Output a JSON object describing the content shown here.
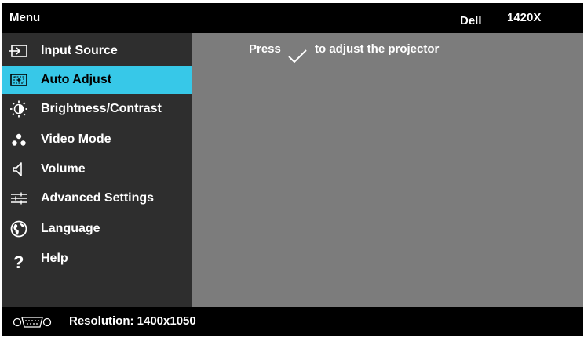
{
  "header": {
    "menu_title": "Menu",
    "brand": "Dell",
    "model": "1420X"
  },
  "sidebar": {
    "items": [
      {
        "label": "Input Source",
        "icon": "input-source-icon",
        "selected": false
      },
      {
        "label": "Auto Adjust",
        "icon": "auto-adjust-icon",
        "selected": true
      },
      {
        "label": "Brightness/Contrast",
        "icon": "brightness-icon",
        "selected": false
      },
      {
        "label": "Video Mode",
        "icon": "video-mode-icon",
        "selected": false
      },
      {
        "label": "Volume",
        "icon": "volume-icon",
        "selected": false
      },
      {
        "label": "Advanced Settings",
        "icon": "sliders-icon",
        "selected": false
      },
      {
        "label": "Language",
        "icon": "globe-icon",
        "selected": false
      },
      {
        "label": "Help",
        "icon": "help-icon",
        "selected": false
      }
    ]
  },
  "content": {
    "hint_press": "Press",
    "hint_rest": "to adjust the projector",
    "hint_icon": "checkmark-icon"
  },
  "footer": {
    "resolution": "Resolution: 1400x1050",
    "icon": "vga-connector-icon"
  },
  "colors": {
    "selected_bg": "#37c8e8",
    "sidebar_bg": "#2e2e2e",
    "content_bg": "#7c7c7c",
    "bar_bg": "#000000"
  }
}
